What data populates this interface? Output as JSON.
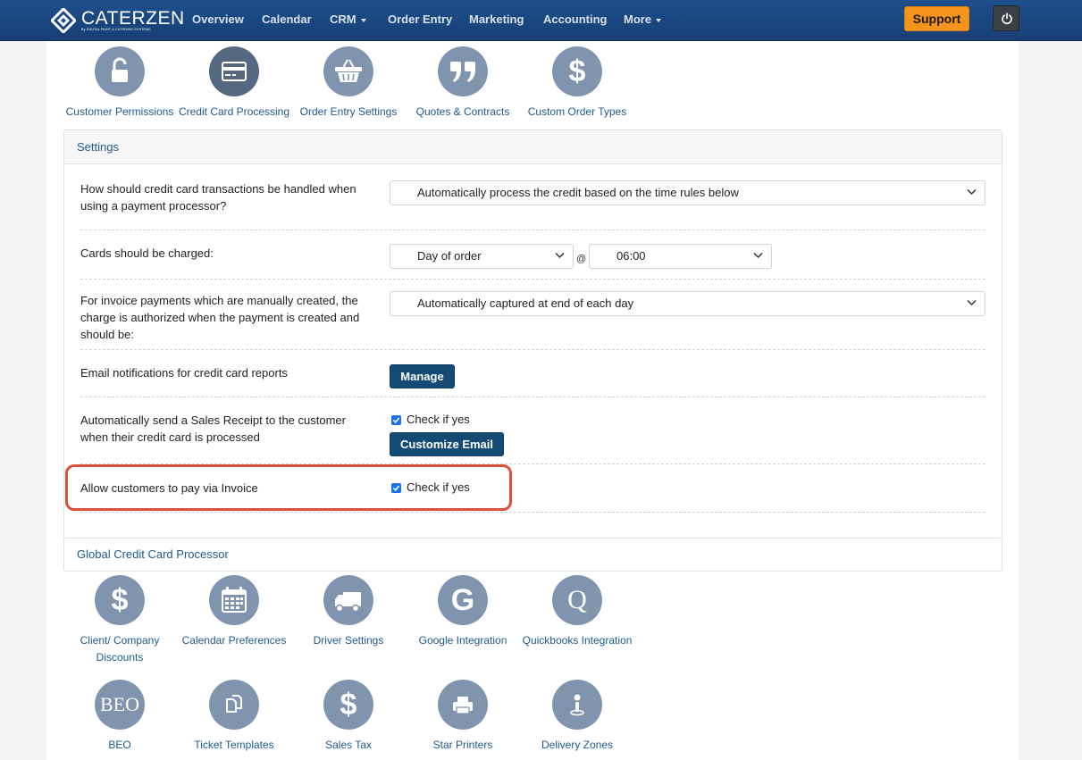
{
  "brand": {
    "name": "CATERZEN",
    "tagline": "By DIGITAL PAINT & CATERING SYSTEMS"
  },
  "nav": {
    "items": [
      {
        "label": "Overview",
        "dropdown": false
      },
      {
        "label": "Calendar",
        "dropdown": false
      },
      {
        "label": "CRM",
        "dropdown": true
      },
      {
        "label": "Order Entry",
        "dropdown": false
      },
      {
        "label": "Marketing",
        "dropdown": false
      },
      {
        "label": "Accounting",
        "dropdown": false
      },
      {
        "label": "More",
        "dropdown": true
      }
    ],
    "support_label": "Support"
  },
  "top_icons": [
    {
      "label": "Customer Permissions",
      "icon": "unlock-icon"
    },
    {
      "label": "Credit Card Processing",
      "icon": "credit-card-icon"
    },
    {
      "label": "Order Entry Settings",
      "icon": "basket-icon"
    },
    {
      "label": "Quotes & Contracts",
      "icon": "quote-icon"
    },
    {
      "label": "Custom Order Types",
      "icon": "dollar-icon"
    }
  ],
  "settings": {
    "title": "Settings",
    "transaction_handling": {
      "label": "How should credit card transactions be handled when using a payment processor?",
      "value": "Automatically process the credit based on the time rules below"
    },
    "charge_timing": {
      "label": "Cards should be charged:",
      "day_value": "Day of order",
      "at": "@",
      "time_value": "06:00"
    },
    "invoice_payments": {
      "label": "For invoice payments which are manually created, the charge is authorized when the payment is created and should be:",
      "value": "Automatically captured at end of each day"
    },
    "email_notifications": {
      "label": "Email notifications for credit card reports",
      "button": "Manage"
    },
    "sales_receipt": {
      "label": "Automatically send a Sales Receipt to the customer when their credit card is processed",
      "check_label": "Check if yes",
      "checked": true,
      "button": "Customize Email"
    },
    "pay_via_invoice": {
      "label": "Allow customers to pay via Invoice",
      "check_label": "Check if yes",
      "checked": true
    }
  },
  "global_processor": {
    "title": "Global Credit Card Processor"
  },
  "bottom_icons_row1": [
    {
      "label_line1": "Client/ Company",
      "label_line2": "Discounts",
      "icon": "dollar-icon"
    },
    {
      "label_line1": "Calendar Preferences",
      "label_line2": "",
      "icon": "calendar-icon"
    },
    {
      "label_line1": "Driver Settings",
      "label_line2": "",
      "icon": "truck-icon"
    },
    {
      "label_line1": "Google Integration",
      "label_line2": "",
      "icon": "google-icon"
    },
    {
      "label_line1": "Quickbooks Integration",
      "label_line2": "",
      "icon": "quickbooks-icon"
    }
  ],
  "bottom_icons_row2": [
    {
      "label": "BEO",
      "icon": "beo-icon",
      "glyph": "BEO"
    },
    {
      "label": "Ticket Templates",
      "icon": "copy-icon"
    },
    {
      "label": "Sales Tax",
      "icon": "dollar-icon"
    },
    {
      "label": "Star Printers",
      "icon": "printer-icon"
    },
    {
      "label": "Delivery Zones",
      "icon": "map-pin-icon"
    }
  ],
  "glyphs": {
    "google": "G",
    "quickbooks": "Q"
  },
  "colors": {
    "nav_bg": "#1d4f8c",
    "accent_orange": "#f7941d",
    "icon_circle": "#8194ae",
    "link_blue": "#1d5a8e",
    "button_dark": "#134b75",
    "highlight_red": "#d9503b"
  }
}
